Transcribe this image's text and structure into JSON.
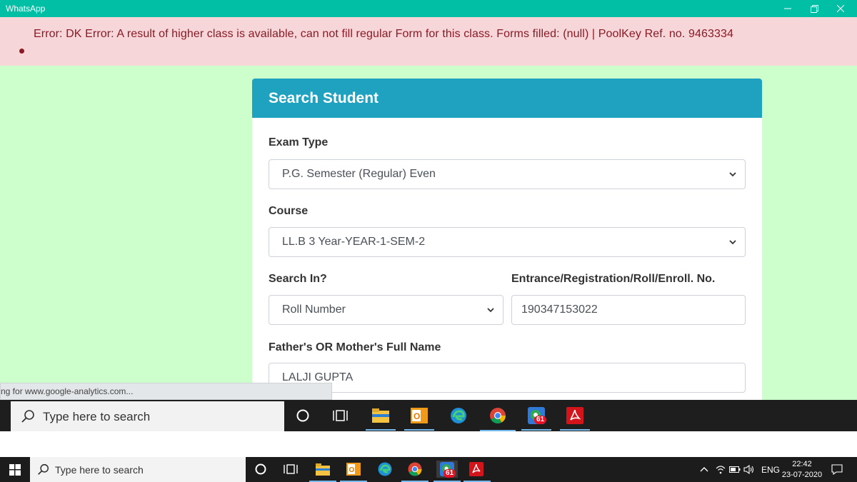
{
  "window": {
    "title": "WhatsApp",
    "minimize_icon": "minimize-icon",
    "maximize_icon": "restore-icon",
    "close_icon": "close-icon"
  },
  "error": {
    "message": "Error: DK Error: A result of higher class is available, can not fill regular Form for this class. Forms filled: (null) | PoolKey Ref. no. 9463334"
  },
  "card": {
    "title": "Search Student",
    "exam_type": {
      "label": "Exam Type",
      "value": "P.G. Semester (Regular) Even"
    },
    "course": {
      "label": "Course",
      "value": "LL.B 3 Year-YEAR-1-SEM-2"
    },
    "search_in": {
      "label": "Search In?",
      "value": "Roll Number"
    },
    "roll_no": {
      "label": "Entrance/Registration/Roll/Enroll. No.",
      "value": "190347153022"
    },
    "parent_name": {
      "label": "Father's OR Mother's Full Name",
      "value": "LALJI GUPTA"
    }
  },
  "status": {
    "text": "ng for www.google-analytics.com..."
  },
  "inner_taskbar": {
    "search_placeholder": "Type here to search",
    "icons": [
      "cortana-icon",
      "task-view-icon",
      "file-explorer-icon",
      "outlook-icon",
      "edge-icon",
      "chrome-icon",
      "chrome-app-icon",
      "acrobat-icon"
    ],
    "badge": "61"
  },
  "taskbar": {
    "search_placeholder": "Type here to search",
    "badge": "61",
    "lang": "ENG",
    "time": "22:42",
    "date": "23-07-2020"
  },
  "colors": {
    "titlebar": "#00bfa5",
    "error_bg": "#f7d6da",
    "error_text": "#8b1a24",
    "page_bg": "#ccffcc",
    "card_header": "#1fa1c0"
  }
}
